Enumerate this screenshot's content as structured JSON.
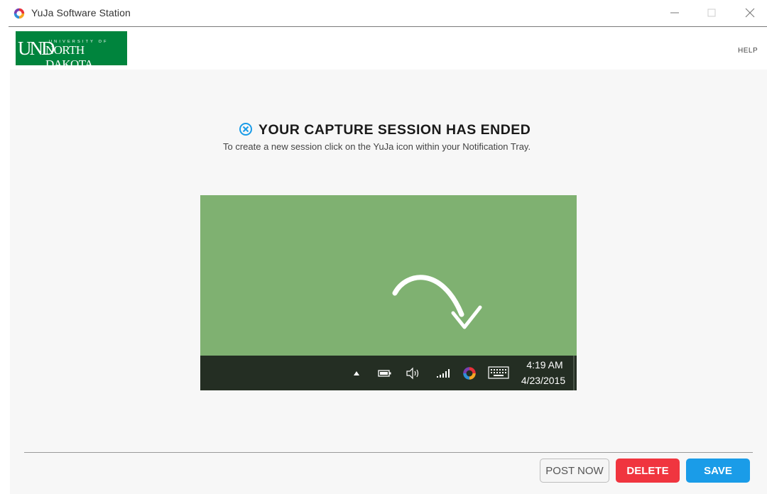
{
  "window": {
    "title": "YuJa Software Station",
    "controls": {
      "minimize": "—",
      "maximize": "☐",
      "close": "✕"
    }
  },
  "header": {
    "logo": {
      "und": "UND",
      "university_of": "UNIVERSITY OF",
      "north_dakota": "NORTH DAKOTA",
      "bg_color": "#00843d"
    },
    "help_label": "HELP"
  },
  "main": {
    "title": "YOUR CAPTURE SESSION HAS ENDED",
    "subtitle": "To create a new session click on the YuJa icon within your Notification Tray.",
    "icon": "circle-x-icon",
    "illustration": {
      "bg_color": "#7fb171",
      "taskbar_color": "#242e23",
      "tray_icons": [
        "caret-up-icon",
        "battery-icon",
        "speaker-icon",
        "signal-icon",
        "yuja-icon",
        "keyboard-icon"
      ],
      "time": "4:19 AM",
      "date": "4/23/2015"
    }
  },
  "footer": {
    "post_now_label": "POST NOW",
    "delete_label": "DELETE",
    "save_label": "SAVE",
    "colors": {
      "delete": "#f0353f",
      "save": "#1a9ce8"
    }
  }
}
